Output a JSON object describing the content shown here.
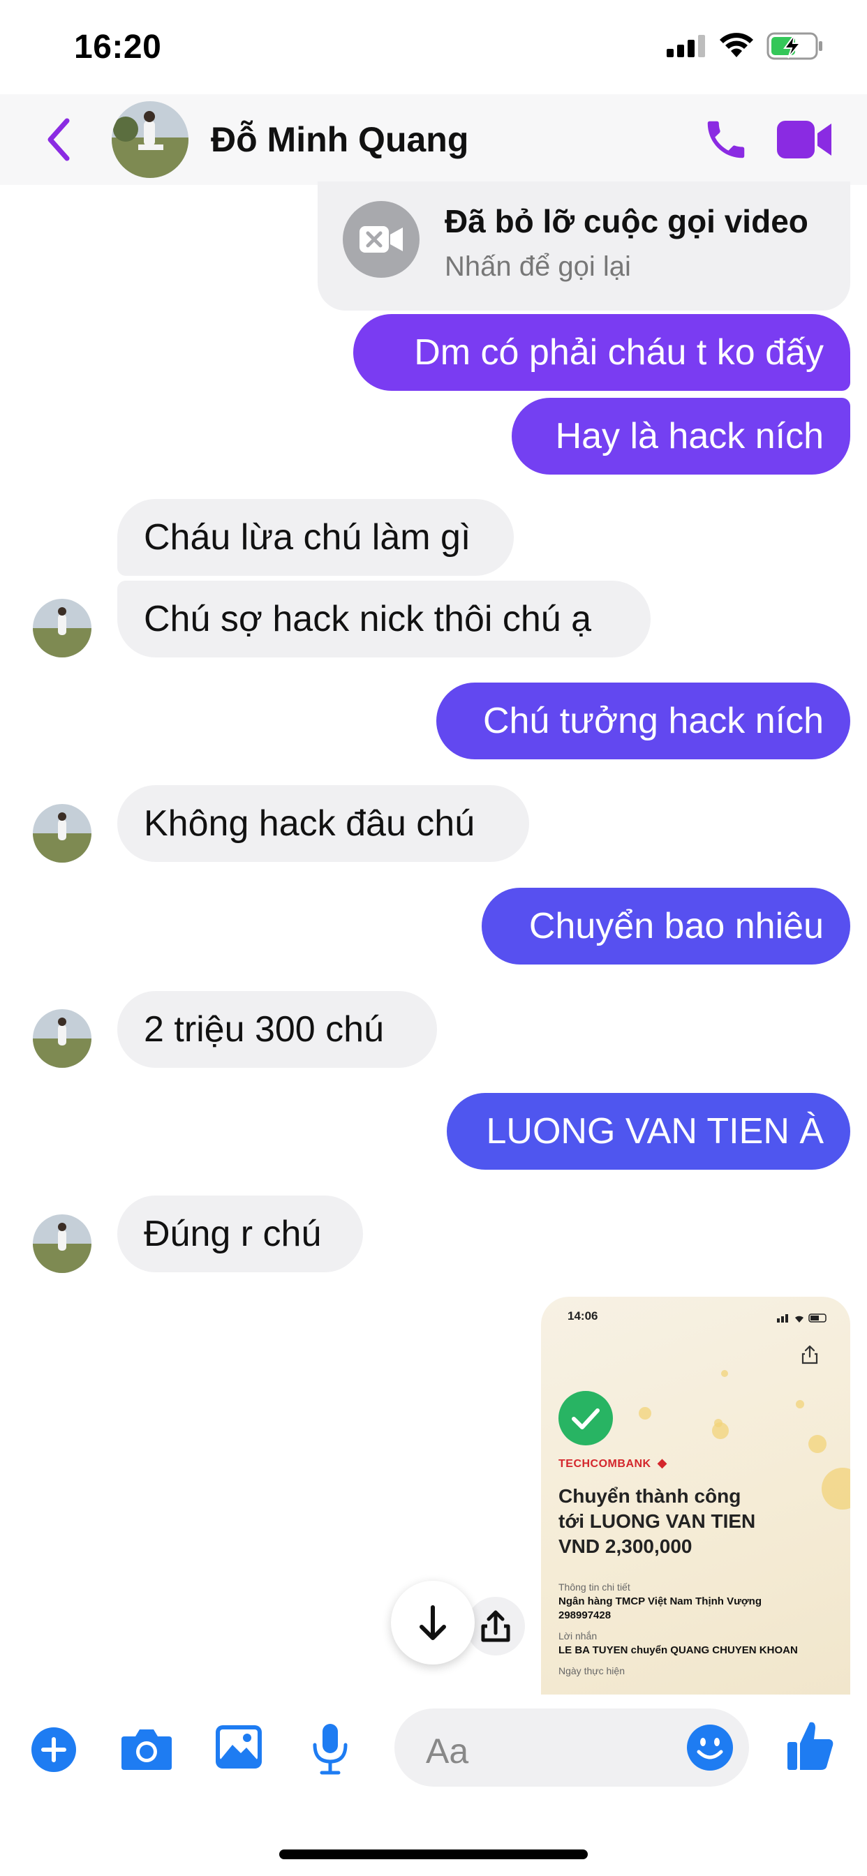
{
  "status_bar": {
    "time": "16:20"
  },
  "header": {
    "contact_name": "Đỗ Minh Quang"
  },
  "missed_call": {
    "title": "Đã bỏ lỡ cuộc gọi video",
    "subtitle": "Nhấn để gọi lại"
  },
  "messages": [
    {
      "dir": "out",
      "text": "Dm có phải cháu t ko đấy"
    },
    {
      "dir": "out",
      "text": "Hay là hack ních"
    },
    {
      "dir": "in",
      "text": "Cháu lừa chú làm gì"
    },
    {
      "dir": "in",
      "text": "Chú sợ hack nick thôi chú ạ"
    },
    {
      "dir": "out",
      "text": "Chú tưởng hack ních"
    },
    {
      "dir": "in",
      "text": "Không hack đâu chú"
    },
    {
      "dir": "out",
      "text": "Chuyển bao nhiêu"
    },
    {
      "dir": "in",
      "text": "2 triệu 300 chú"
    },
    {
      "dir": "out",
      "text": "LUONG VAN TIEN À"
    },
    {
      "dir": "in",
      "text": "Đúng r chú"
    }
  ],
  "receipt": {
    "time": "14:06",
    "bank": "TECHCOMBANK",
    "title_line1": "Chuyển thành công",
    "title_line2": "tới LUONG VAN TIEN",
    "amount": "VND 2,300,000",
    "details_label": "Thông tin chi tiết",
    "bank_name": "Ngân hàng TMCP Việt Nam Thịnh Vượng",
    "account": "298997428",
    "note_label": "Lời nhắn",
    "note": "LE BA TUYEN chuyển QUANG CHUYEN KHOAN",
    "date_label": "Ngày thực hiện"
  },
  "composer": {
    "placeholder": "Aa"
  },
  "colors": {
    "accent": "#6f3ef3",
    "icon_blue": "#1e7cf2",
    "incoming_bubble": "#f0f0f2"
  },
  "icons": [
    "back-icon",
    "phone-icon",
    "video-icon",
    "missed-video-icon",
    "plus-icon",
    "camera-icon",
    "gallery-icon",
    "mic-icon",
    "emoji-icon",
    "like-icon",
    "arrow-down-icon",
    "share-icon"
  ]
}
